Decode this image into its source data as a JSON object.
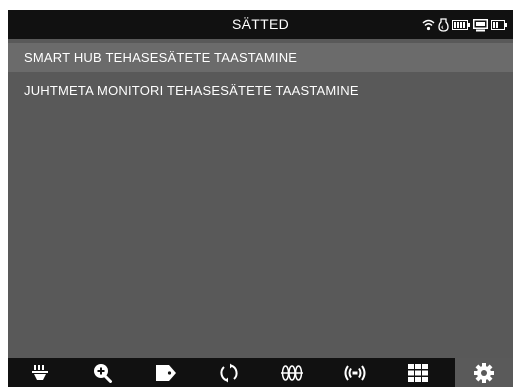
{
  "header": {
    "title": "SÄTTED",
    "status_icons": [
      "wifi-icon",
      "nightlight-icon",
      "monitor-battery-icon",
      "smart-hub-icon",
      "hub-battery-icon"
    ]
  },
  "menu": {
    "items": [
      {
        "label": "SMART HUB TEHASESÄTETE TAASTAMINE",
        "selected": true
      },
      {
        "label": "JUHTMETA MONITORI TEHASESÄTETE TAASTAMINE",
        "selected": false
      }
    ]
  },
  "toolbar": {
    "buttons": [
      {
        "icon": "bottle-icon",
        "active": false
      },
      {
        "icon": "zoom-icon",
        "active": false
      },
      {
        "icon": "tag-icon",
        "active": false
      },
      {
        "icon": "rotate-icon",
        "active": false
      },
      {
        "icon": "temperature-icon",
        "active": false
      },
      {
        "icon": "sound-icon",
        "active": false
      },
      {
        "icon": "grid-icon",
        "active": false
      },
      {
        "icon": "settings-icon",
        "active": true
      }
    ]
  },
  "colors": {
    "screen_bg": "#595959",
    "bar_bg": "#111111",
    "selected_row": "#6b6b6b",
    "text": "#ffffff"
  }
}
